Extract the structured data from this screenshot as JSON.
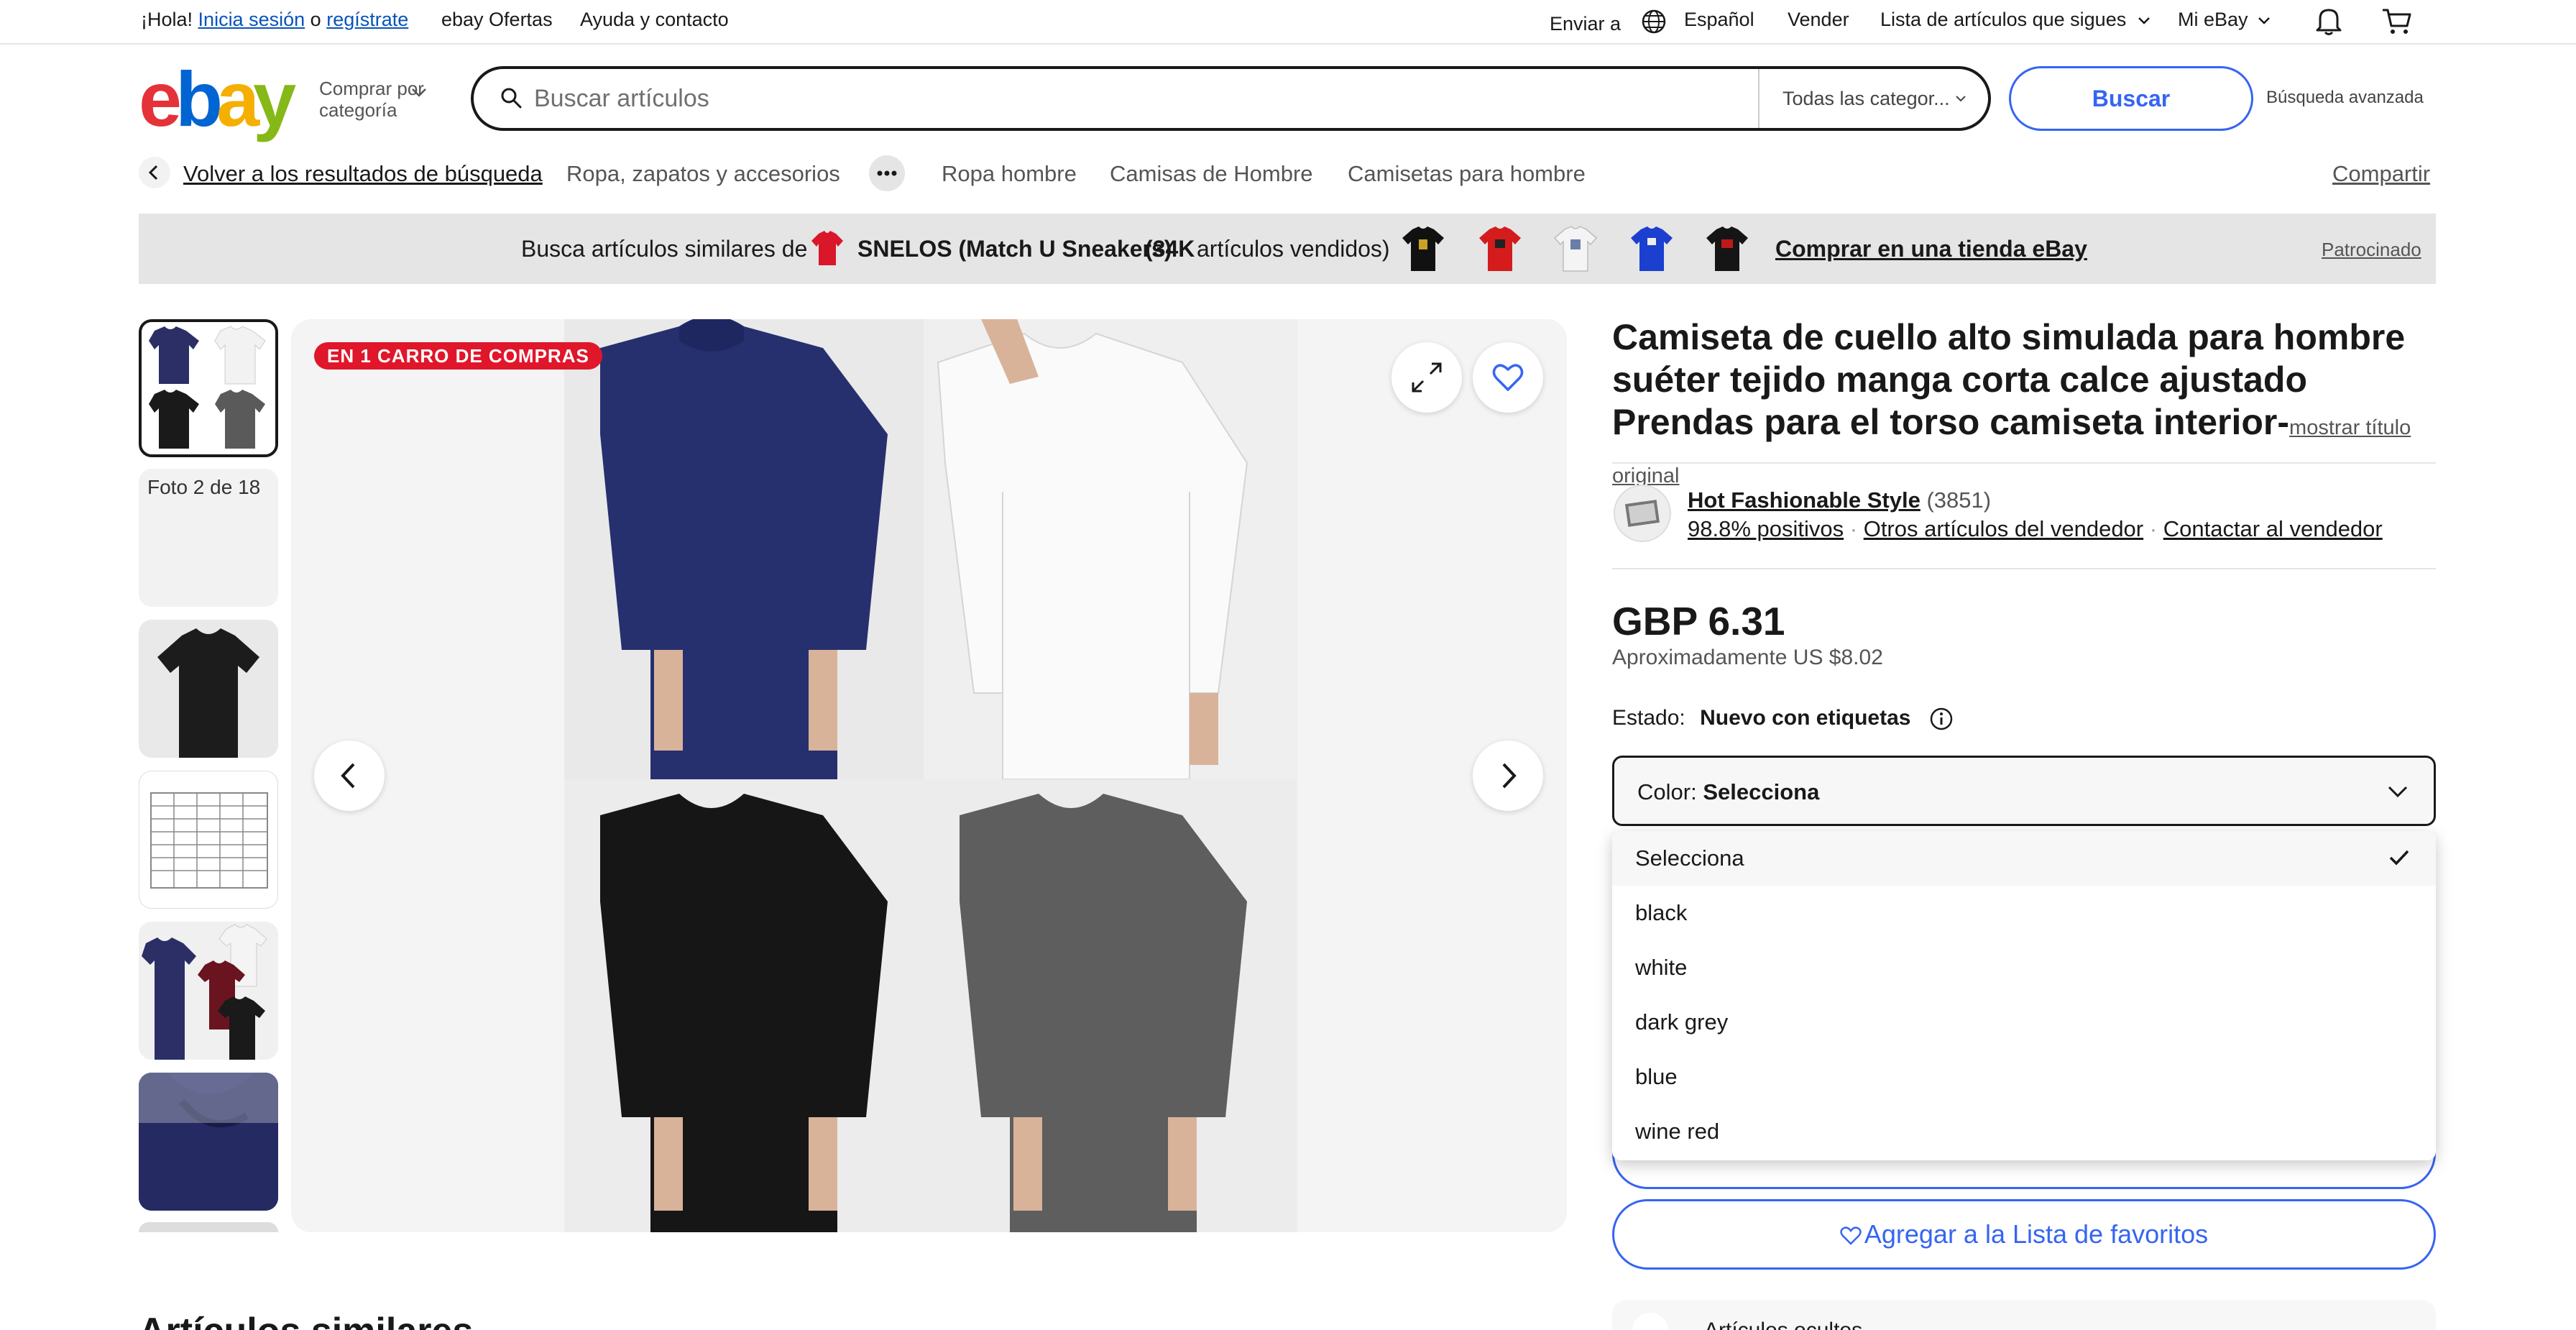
{
  "topbar": {
    "greeting": "¡Hola!",
    "signin": "Inicia sesión",
    "or": "o",
    "register": "regístrate",
    "deals": "ebay Ofertas",
    "help": "Ayuda y contacto",
    "ship_to": "Enviar a",
    "language": "Español",
    "sell": "Vender",
    "watchlist": "Lista de artículos que sigues",
    "my_ebay": "Mi eBay"
  },
  "header": {
    "logo": [
      "e",
      "b",
      "a",
      "y"
    ],
    "logo_colors": [
      "#e53238",
      "#0064d2",
      "#f5af02",
      "#86b817"
    ],
    "shop_by_line1": "Comprar por",
    "shop_by_line2": "categoría",
    "search_placeholder": "Buscar artículos",
    "category_select": "Todas las categor...",
    "search_button": "Buscar",
    "advanced": "Búsqueda avanzada"
  },
  "breadcrumb": {
    "back": "Volver a los resultados de búsqueda",
    "items": [
      "Ropa, zapatos y accesorios",
      "Ropa hombre",
      "Camisas de Hombre",
      "Camisetas para hombre"
    ],
    "share": "Compartir"
  },
  "banner": {
    "prefix": "Busca artículos similares de",
    "store": "SNELOS (Match U Sneakers)",
    "sold": "(34K",
    "sold_suffix": "artículos vendidos)",
    "cta": "Comprar en una tienda eBay",
    "sponsored": "Patrocinado"
  },
  "gallery": {
    "counter": "Foto 2 de 18",
    "cart_badge": "EN 1 CARRO DE COMPRAS"
  },
  "product": {
    "title": "Camiseta de cuello alto simulada para hombre suéter tejido manga corta calce ajustado Prendas para el torso camiseta interior-",
    "show_original": "mostrar título original",
    "seller_name": "Hot Fashionable Style",
    "seller_count": "(3851)",
    "positive": "98.8% positivos",
    "other_items": "Otros artículos del vendedor",
    "contact": "Contactar al vendedor",
    "price": "GBP 6.31",
    "approx": "Aproximadamente US $8.02",
    "condition_label": "Estado:",
    "condition_value": "Nuevo con etiquetas",
    "color_label": "Color:",
    "color_value": "Selecciona",
    "watchlist_button": "Agregar a la Lista de favoritos",
    "ship_text": "Artículos ocultos"
  },
  "dropdown": {
    "options": [
      "Selecciona",
      "black",
      "white",
      "dark grey",
      "blue",
      "wine red"
    ],
    "selected": 0
  },
  "similar_heading": "Artículos similares"
}
